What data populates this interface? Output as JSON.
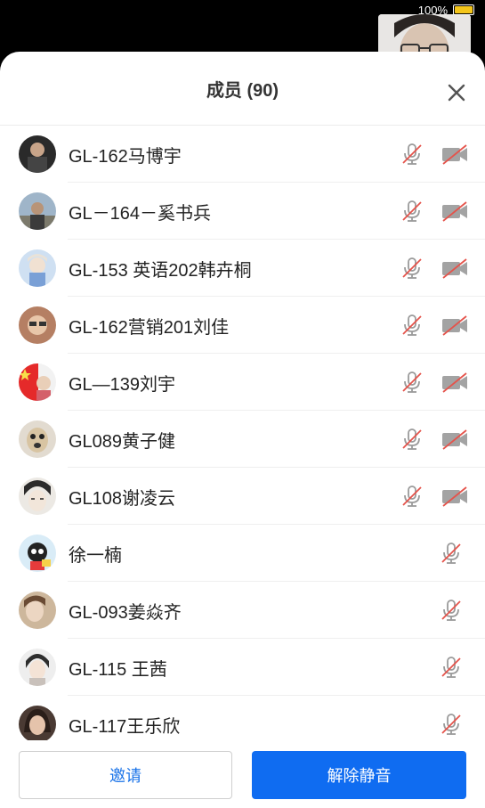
{
  "status": {
    "battery_text": "100%"
  },
  "sheet": {
    "title": "成员 (90)",
    "close_icon": "close-icon"
  },
  "members": [
    {
      "name": "GL-162马博宇",
      "mic": "mic-muted-icon",
      "camera": "camera-off-icon"
    },
    {
      "name": "GL－164－奚书兵",
      "mic": "mic-muted-icon",
      "camera": "camera-off-icon"
    },
    {
      "name": "GL-153 英语202韩卉桐",
      "mic": "mic-muted-icon",
      "camera": "camera-off-icon"
    },
    {
      "name": "GL-162营销201刘佳",
      "mic": "mic-muted-icon",
      "camera": "camera-off-icon"
    },
    {
      "name": "GL—139刘宇",
      "mic": "mic-muted-icon",
      "camera": "camera-off-icon"
    },
    {
      "name": "GL089黄子健",
      "mic": "mic-muted-icon",
      "camera": "camera-off-icon"
    },
    {
      "name": "GL108谢凌云",
      "mic": "mic-muted-icon",
      "camera": "camera-off-icon"
    },
    {
      "name": "徐一楠",
      "mic": "mic-muted-icon",
      "camera": ""
    },
    {
      "name": "GL-093姜焱齐",
      "mic": "mic-muted-icon",
      "camera": ""
    },
    {
      "name": "GL-115 王茜",
      "mic": "mic-muted-icon",
      "camera": ""
    },
    {
      "name": "GL-117王乐欣",
      "mic": "mic-muted-icon",
      "camera": ""
    }
  ],
  "footer": {
    "invite_label": "邀请",
    "unmute_label": "解除静音"
  },
  "colors": {
    "primary": "#0f6cf1",
    "invite_text": "#1a73e8",
    "muted_red": "#e5534b",
    "icon_gray": "#9a9a9a"
  }
}
